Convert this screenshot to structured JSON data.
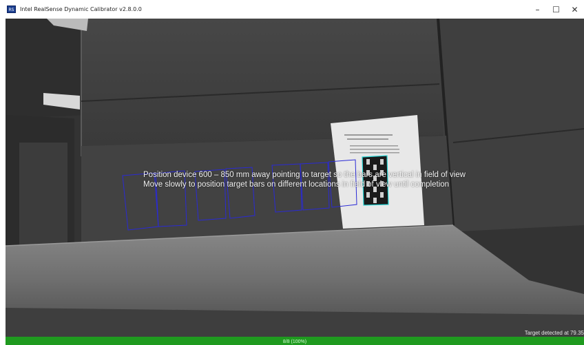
{
  "window": {
    "title": "Intel RealSense Dynamic Calibrator v2.8.0.0",
    "icon": "intel-realsense-app-icon",
    "controls": {
      "minimize": "–",
      "maximize": "☐",
      "close": "✕"
    }
  },
  "feed": {
    "instructions": [
      "Position device 600 – 850 mm away pointing to target so the bars are vertical in field of view",
      "Move slowly to position target bars on different locations in field of view until completion"
    ],
    "status": "Target detected at 79.35",
    "target_outline_color": "#2a2ad6",
    "detected_target_color": "#2ad6d6"
  },
  "progress": {
    "label": "8/8 (100%)",
    "fraction": 1.0,
    "color": "#1f9a1f"
  }
}
